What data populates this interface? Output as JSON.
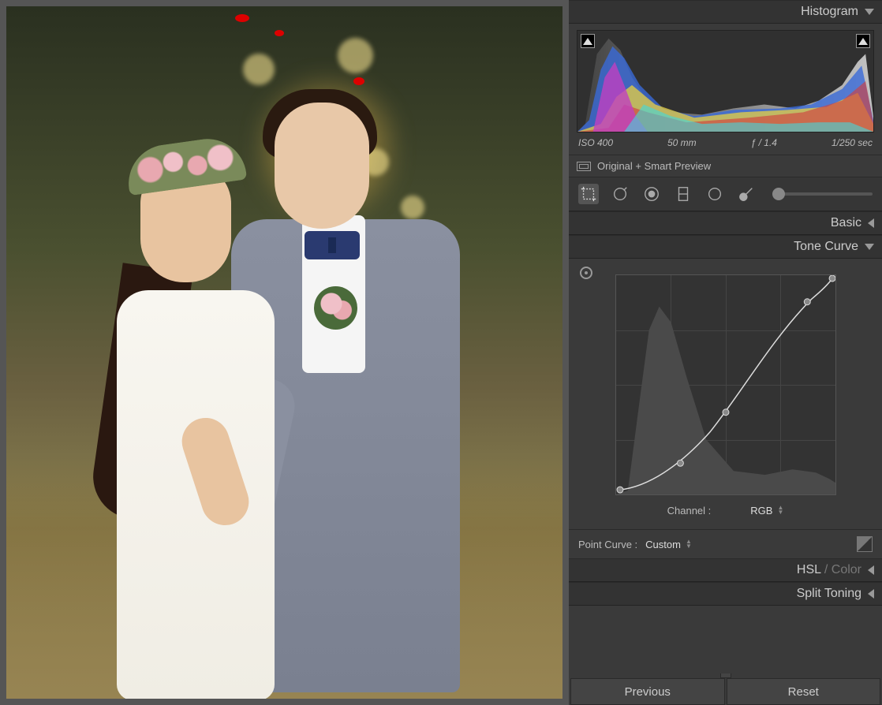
{
  "panels": {
    "histogram": {
      "title": "Histogram"
    },
    "basic": {
      "title": "Basic"
    },
    "tone_curve": {
      "title": "Tone Curve"
    },
    "hsl_color": {
      "title_prefix": "HSL",
      "title_suffix": " / Color"
    },
    "split_toning": {
      "title": "Split Toning"
    }
  },
  "exif": {
    "iso": "ISO 400",
    "focal": "50 mm",
    "aperture": "ƒ / 1.4",
    "shutter": "1/250 sec"
  },
  "preview_mode": "Original + Smart Preview",
  "tone_curve": {
    "channel_label": "Channel :",
    "channel_value": "RGB",
    "point_curve_label": "Point Curve :",
    "point_curve_value": "Custom"
  },
  "buttons": {
    "previous": "Previous",
    "reset": "Reset"
  },
  "icons": {
    "crop": "crop-icon",
    "spot": "spot-removal-icon",
    "redeye": "red-eye-icon",
    "grad": "graduated-filter-icon",
    "radial": "radial-filter-icon",
    "brush": "adjustment-brush-icon"
  }
}
